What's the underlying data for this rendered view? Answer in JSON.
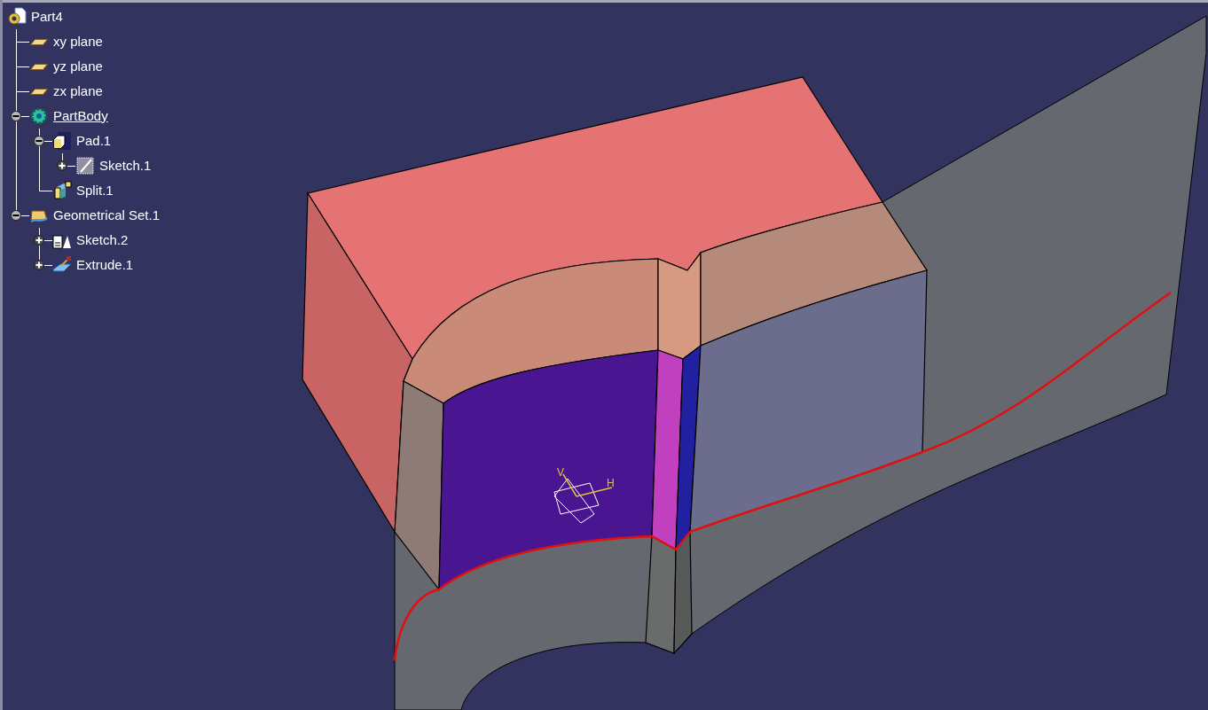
{
  "tree": {
    "label": "Part4",
    "kind": "part",
    "current": false,
    "children": [
      {
        "label": "xy plane",
        "kind": "plane",
        "current": false
      },
      {
        "label": "yz plane",
        "kind": "plane",
        "current": false
      },
      {
        "label": "zx plane",
        "kind": "plane",
        "current": false
      },
      {
        "label": "PartBody",
        "kind": "body",
        "current": true,
        "expanded": true,
        "children": [
          {
            "label": "Pad.1",
            "kind": "pad",
            "current": false,
            "expanded": true,
            "children": [
              {
                "label": "Sketch.1",
                "kind": "sketch",
                "current": false,
                "expanded": false
              }
            ]
          },
          {
            "label": "Split.1",
            "kind": "split",
            "current": false
          }
        ]
      },
      {
        "label": "Geometrical Set.1",
        "kind": "geoset",
        "current": false,
        "expanded": true,
        "children": [
          {
            "label": "Sketch.2",
            "kind": "sketch2",
            "current": false,
            "expanded": false
          },
          {
            "label": "Extrude.1",
            "kind": "extrude",
            "current": false,
            "expanded": false
          }
        ]
      }
    ]
  },
  "viewport": {
    "axis_labels": [
      "V",
      "H"
    ]
  }
}
